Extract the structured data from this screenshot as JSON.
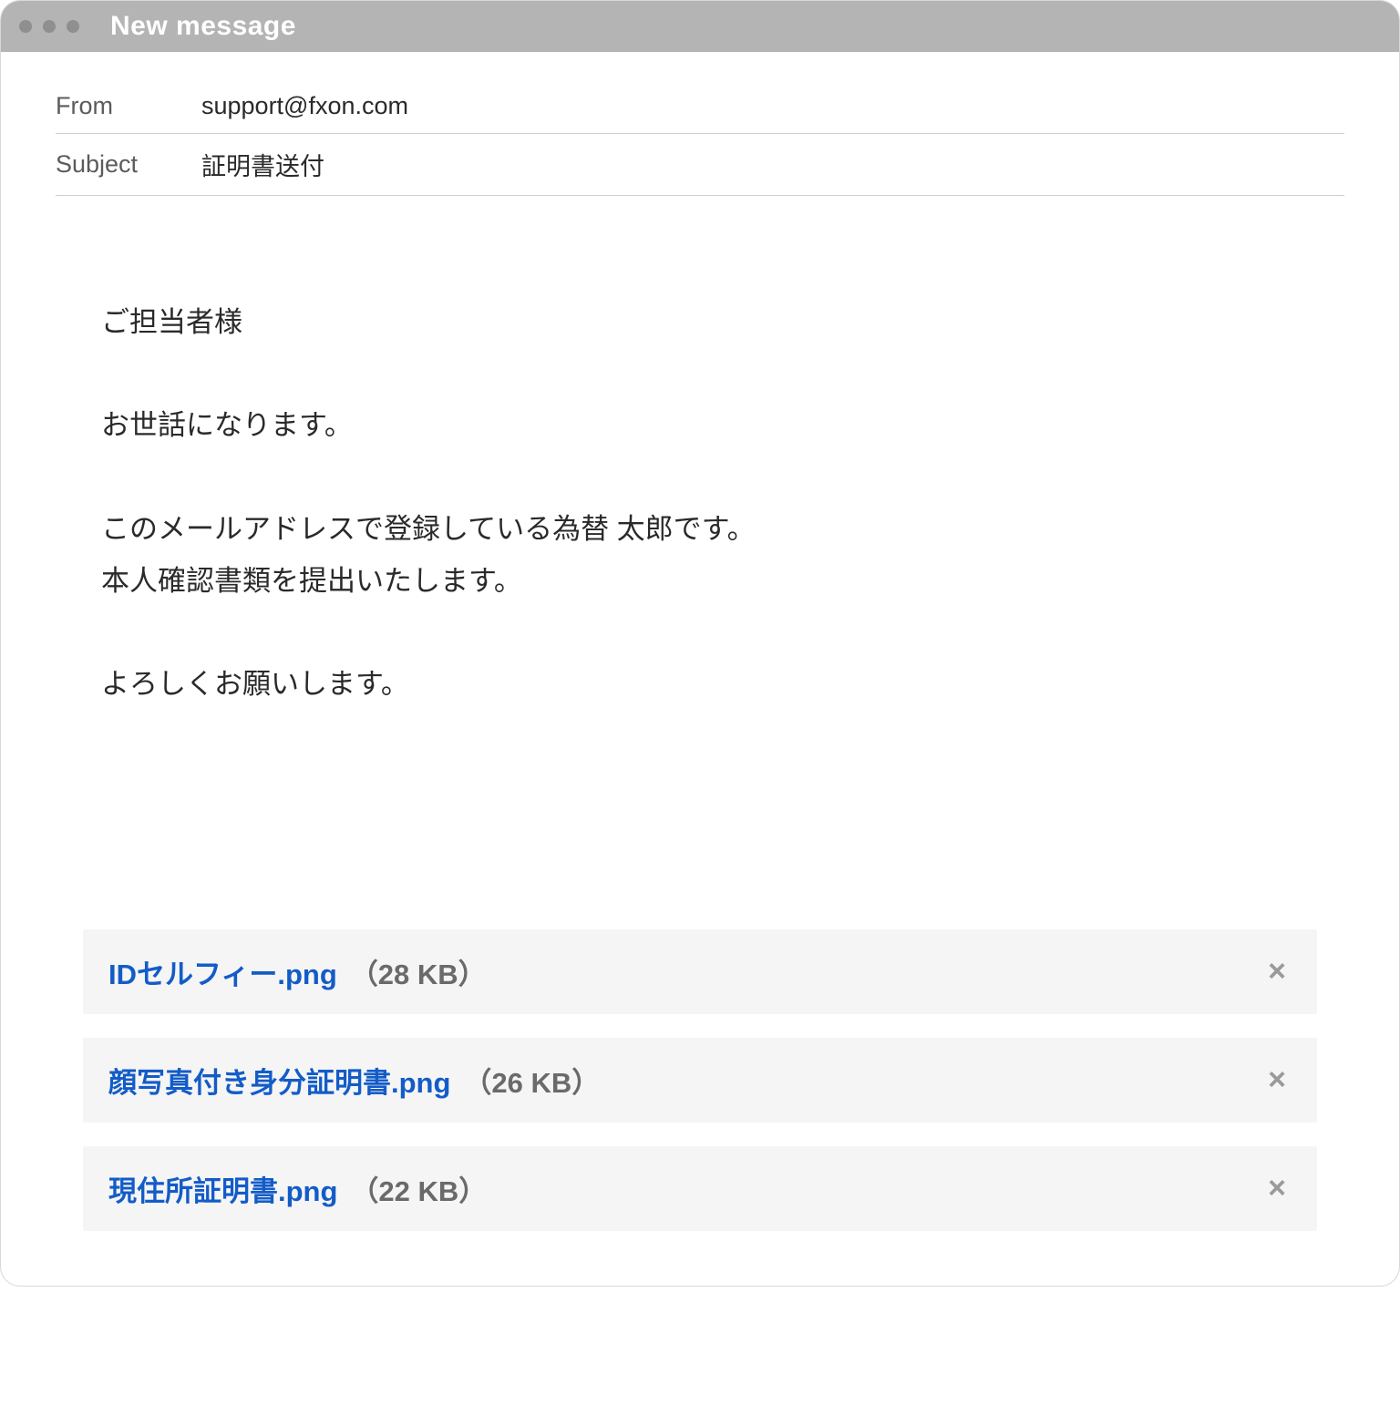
{
  "window": {
    "title": "New message"
  },
  "header": {
    "from_label": "From",
    "from_value": "support@fxon.com",
    "subject_label": "Subject",
    "subject_value": "証明書送付"
  },
  "body": {
    "line1": "ご担当者様",
    "line2": "お世話になります。",
    "line3": "このメールアドレスで登録している為替 太郎です。",
    "line4": "本人確認書類を提出いたします。",
    "line5": "よろしくお願いします。"
  },
  "attachments": [
    {
      "name": "IDセルフィー.png",
      "size": "（28 KB）"
    },
    {
      "name": "顔写真付き身分証明書.png",
      "size": "（26 KB）"
    },
    {
      "name": "現住所証明書.png",
      "size": "（22 KB）"
    }
  ]
}
